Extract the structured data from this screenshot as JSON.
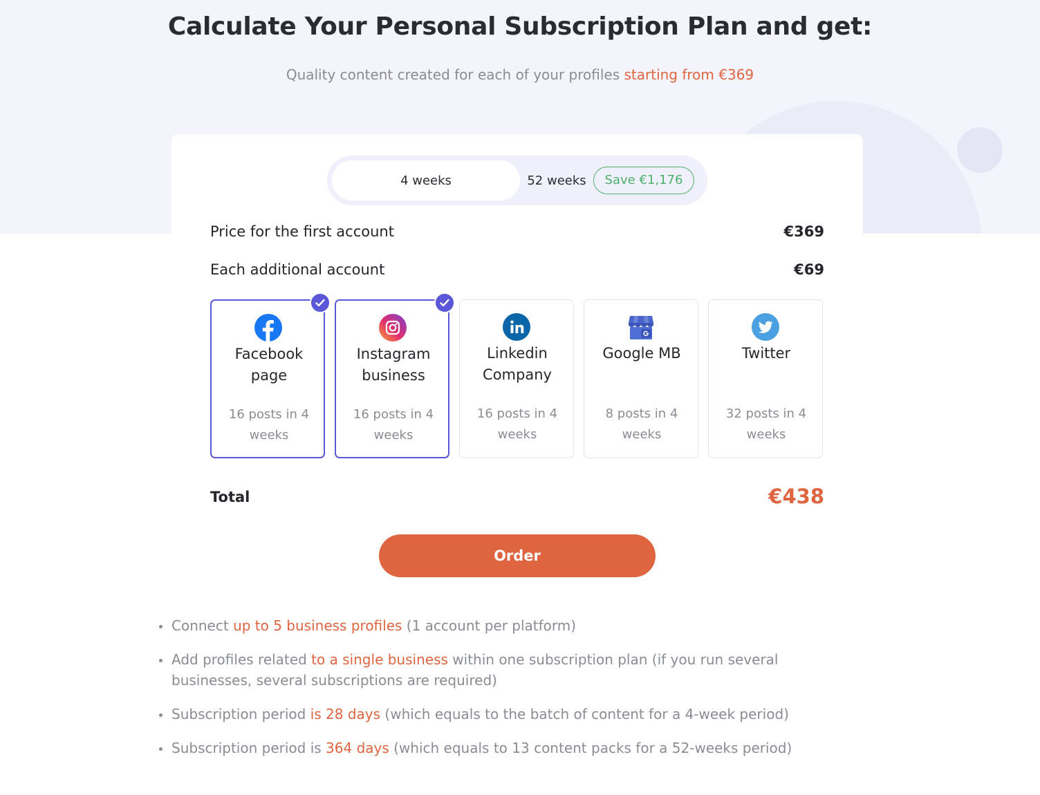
{
  "header": {
    "title": "Calculate Your Personal Subscription Plan and get:",
    "subtitle_prefix": "Quality content created for each of your profiles ",
    "subtitle_accent": "starting from €369"
  },
  "period_toggle": {
    "option_1": "4 weeks",
    "option_2": "52 weeks",
    "save_badge": "Save €1,176",
    "selected": "4 weeks"
  },
  "pricing": {
    "first_label": "Price for the first account",
    "first_value": "€369",
    "additional_label": "Each additional account",
    "additional_value": "€69"
  },
  "platforms": [
    {
      "name_line1": "Facebook",
      "name_line2": "page",
      "posts_line1": "16 posts in 4",
      "posts_line2": "weeks",
      "icon": "facebook-icon",
      "selected": true
    },
    {
      "name_line1": "Instagram",
      "name_line2": "business",
      "posts_line1": "16 posts in 4",
      "posts_line2": "weeks",
      "icon": "instagram-icon",
      "selected": true
    },
    {
      "name_line1": "Linkedin",
      "name_line2": "Company",
      "posts_line1": "16 posts in 4",
      "posts_line2": "weeks",
      "icon": "linkedin-icon",
      "selected": false
    },
    {
      "name_line1": "Google MB",
      "name_line2": "",
      "posts_line1": "8 posts in 4",
      "posts_line2": "weeks",
      "icon": "google-my-business-icon",
      "selected": false
    },
    {
      "name_line1": "Twitter",
      "name_line2": "",
      "posts_line1": "32 posts in 4",
      "posts_line2": "weeks",
      "icon": "twitter-icon",
      "selected": false
    }
  ],
  "total": {
    "label": "Total",
    "value": "€438"
  },
  "order_button": "Order",
  "notes": [
    {
      "pre": "Connect ",
      "accent": "up to 5 business profiles",
      "post": " (1 account per platform)"
    },
    {
      "pre": "Add profiles related ",
      "accent": "to a single business",
      "post": " within one subscription plan (if you run several businesses, several subscriptions are required)"
    },
    {
      "pre": "Subscription period ",
      "accent": "is 28 days",
      "post": " (which equals to the batch of content for a 4-week period)"
    },
    {
      "pre": "Subscription period is ",
      "accent": "364 days",
      "post": " (which equals to 13 content packs for a 52-weeks period)"
    }
  ],
  "colors": {
    "accent": "#df6440",
    "selection": "#5b57d9",
    "save_green": "#4caf6a",
    "hero_background": "#f4f5fc"
  }
}
